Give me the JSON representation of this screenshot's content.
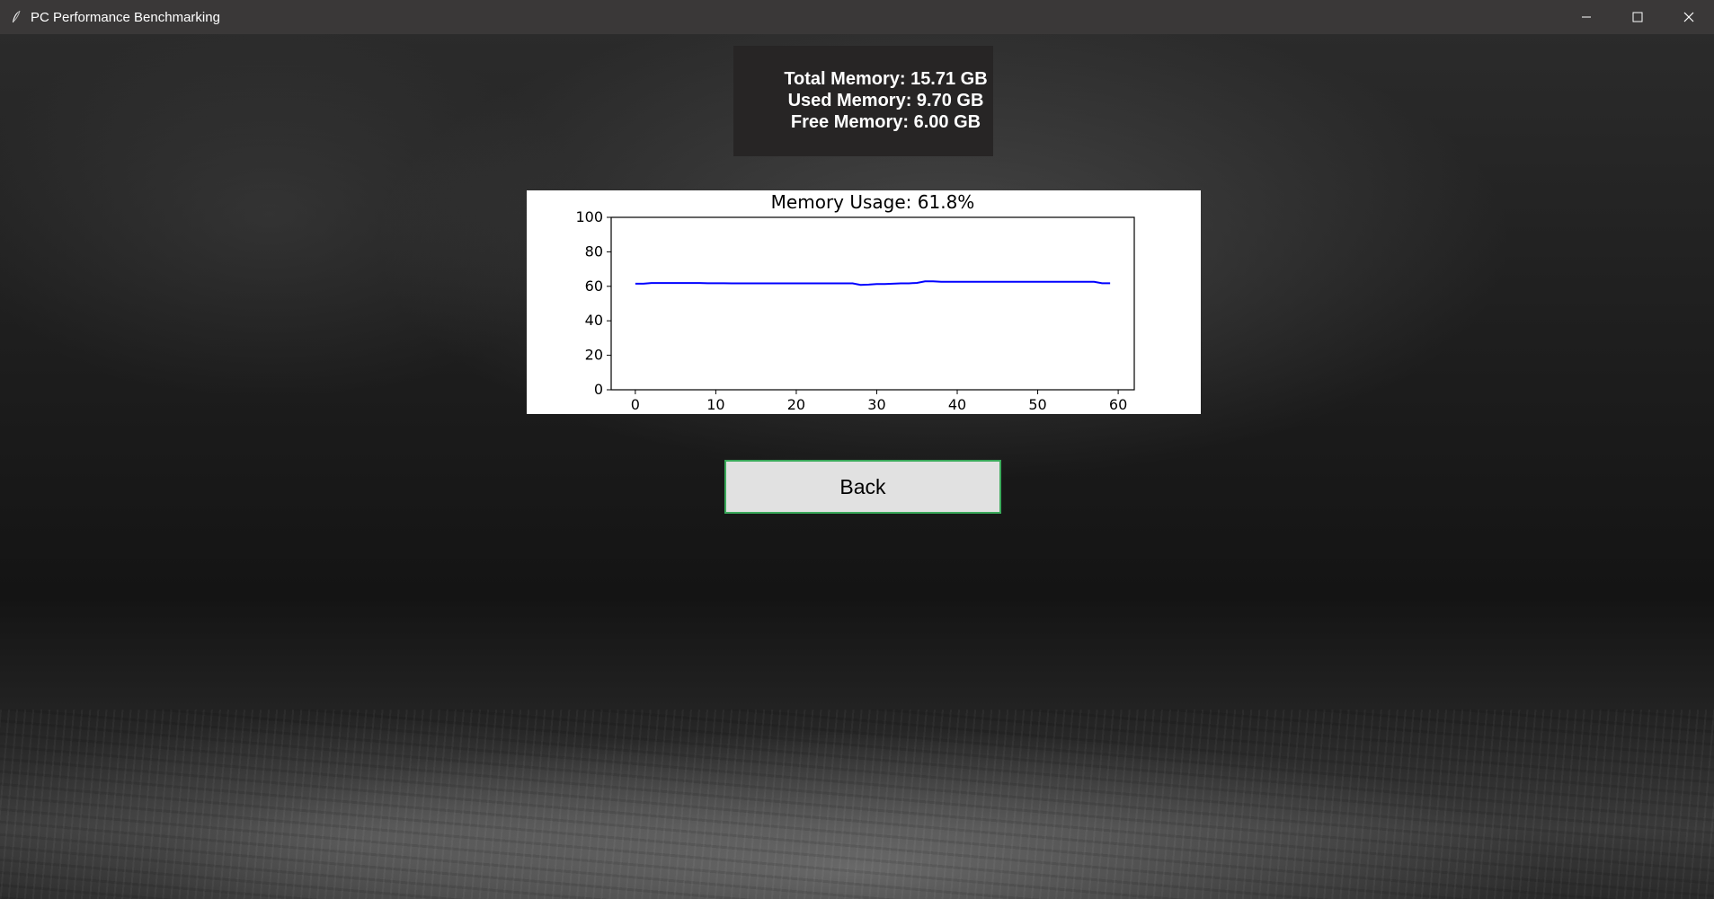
{
  "window": {
    "title": "PC Performance Benchmarking",
    "icon": "feather-icon",
    "controls": [
      "minimize-icon",
      "maximize-icon",
      "close-icon"
    ]
  },
  "memory_info": {
    "total": "Total Memory: 15.71 GB",
    "used": "Used Memory: 9.70 GB",
    "free": "Free Memory: 6.00 GB"
  },
  "back_button": {
    "label": "Back",
    "border_color": "#3aa95a"
  },
  "chart_data": {
    "type": "line",
    "title": "Memory Usage: 61.8%",
    "xlabel": "",
    "ylabel": "",
    "xlim": [
      -3,
      62
    ],
    "ylim": [
      0,
      100
    ],
    "xticks": [
      0,
      10,
      20,
      30,
      40,
      50,
      60
    ],
    "yticks": [
      0,
      20,
      40,
      60,
      80,
      100
    ],
    "grid": false,
    "line_color": "#0000ff",
    "x": [
      0,
      1,
      2,
      3,
      4,
      5,
      6,
      7,
      8,
      9,
      10,
      11,
      12,
      13,
      14,
      15,
      16,
      17,
      18,
      19,
      20,
      21,
      22,
      23,
      24,
      25,
      26,
      27,
      28,
      29,
      30,
      31,
      32,
      33,
      34,
      35,
      36,
      37,
      38,
      39,
      40,
      41,
      42,
      43,
      44,
      45,
      46,
      47,
      48,
      49,
      50,
      51,
      52,
      53,
      54,
      55,
      56,
      57,
      58,
      59
    ],
    "values": [
      61.5,
      61.5,
      61.9,
      61.9,
      61.9,
      61.9,
      61.9,
      61.9,
      61.9,
      61.8,
      61.8,
      61.8,
      61.7,
      61.7,
      61.7,
      61.7,
      61.7,
      61.7,
      61.7,
      61.7,
      61.7,
      61.7,
      61.7,
      61.7,
      61.7,
      61.7,
      61.7,
      61.7,
      60.8,
      61.0,
      61.3,
      61.3,
      61.5,
      61.7,
      61.7,
      62.0,
      62.9,
      62.9,
      62.6,
      62.6,
      62.6,
      62.6,
      62.6,
      62.6,
      62.6,
      62.6,
      62.6,
      62.6,
      62.6,
      62.6,
      62.6,
      62.6,
      62.6,
      62.6,
      62.6,
      62.6,
      62.6,
      62.6,
      61.8,
      61.8
    ]
  }
}
